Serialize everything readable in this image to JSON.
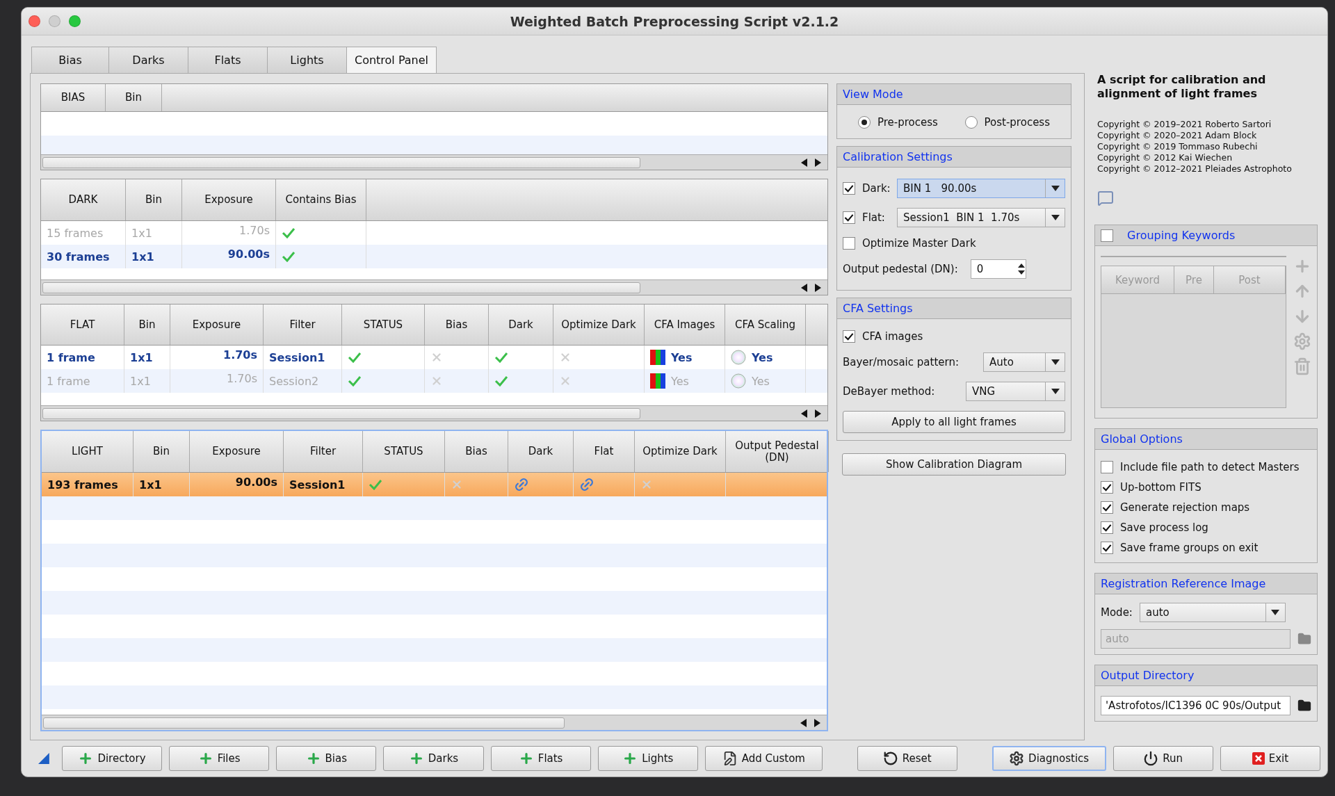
{
  "window": {
    "title": "Weighted Batch Preprocessing Script v2.1.2"
  },
  "tabs": [
    {
      "label": "Bias",
      "selected": false
    },
    {
      "label": "Darks",
      "selected": false
    },
    {
      "label": "Flats",
      "selected": false
    },
    {
      "label": "Lights",
      "selected": false
    },
    {
      "label": "Control Panel",
      "selected": true
    }
  ],
  "tables": [
    {
      "columns": [
        "BIAS",
        "Bin"
      ]
    },
    {
      "columns": [
        "DARK",
        "Bin",
        "Exposure",
        "Contains Bias"
      ],
      "rows": [
        {
          "matched": false,
          "selected": false,
          "cells": [
            {
              "kind": "text",
              "text": "15 frames"
            },
            {
              "kind": "text",
              "text": "1x1"
            },
            {
              "kind": "number",
              "text": "1.70s"
            },
            {
              "kind": "check"
            }
          ]
        },
        {
          "matched": true,
          "selected": false,
          "cells": [
            {
              "kind": "text",
              "text": "30 frames"
            },
            {
              "kind": "text",
              "text": "1x1"
            },
            {
              "kind": "number",
              "text": "90.00s"
            },
            {
              "kind": "check"
            }
          ]
        }
      ]
    },
    {
      "columns": [
        "FLAT",
        "Bin",
        "Exposure",
        "Filter",
        "STATUS",
        "Bias",
        "Dark",
        "Optimize Dark",
        "CFA Images",
        "CFA Scaling"
      ],
      "rows": [
        {
          "matched": true,
          "selected": false,
          "cells": [
            {
              "kind": "text",
              "text": "1 frame"
            },
            {
              "kind": "text",
              "text": "1x1"
            },
            {
              "kind": "number",
              "text": "1.70s"
            },
            {
              "kind": "text",
              "text": "Session1"
            },
            {
              "kind": "check"
            },
            {
              "kind": "cross"
            },
            {
              "kind": "check"
            },
            {
              "kind": "cross"
            },
            {
              "kind": "cfa",
              "text": "Yes"
            },
            {
              "kind": "scaling",
              "text": "Yes"
            }
          ]
        },
        {
          "matched": false,
          "selected": false,
          "cells": [
            {
              "kind": "text",
              "text": "1 frame"
            },
            {
              "kind": "text",
              "text": "1x1"
            },
            {
              "kind": "number",
              "text": "1.70s"
            },
            {
              "kind": "text",
              "text": "Session2"
            },
            {
              "kind": "check"
            },
            {
              "kind": "cross"
            },
            {
              "kind": "check"
            },
            {
              "kind": "cross"
            },
            {
              "kind": "cfa",
              "text": "Yes"
            },
            {
              "kind": "scaling",
              "text": "Yes"
            }
          ]
        }
      ]
    },
    {
      "columns": [
        "LIGHT",
        "Bin",
        "Exposure",
        "Filter",
        "STATUS",
        "Bias",
        "Dark",
        "Flat",
        "Optimize Dark",
        "Output Pedestal (DN)"
      ],
      "rows": [
        {
          "selected": true,
          "cells": [
            {
              "kind": "text",
              "text": "193 frames"
            },
            {
              "kind": "text",
              "text": "1x1"
            },
            {
              "kind": "number",
              "text": "90.00s"
            },
            {
              "kind": "text",
              "text": "Session1"
            },
            {
              "kind": "check"
            },
            {
              "kind": "cross"
            },
            {
              "kind": "link"
            },
            {
              "kind": "link"
            },
            {
              "kind": "cross"
            },
            {
              "kind": "empty"
            }
          ]
        }
      ]
    }
  ],
  "view_mode": {
    "title": "View Mode",
    "options": [
      {
        "label": "Pre-process",
        "selected": true
      },
      {
        "label": "Post-process",
        "selected": false
      }
    ]
  },
  "calibration_settings": {
    "title": "Calibration Settings",
    "dark": {
      "label": "Dark:",
      "checked": true,
      "value": "BIN 1   90.00s",
      "focused": true
    },
    "flat": {
      "label": "Flat:",
      "checked": true,
      "value": "Session1  BIN 1  1.70s",
      "focused": false
    },
    "optimize": {
      "label": "Optimize Master Dark",
      "checked": false
    },
    "pedestal": {
      "label": "Output pedestal (DN):",
      "value": "0"
    }
  },
  "cfa_settings": {
    "title": "CFA Settings",
    "cfa_images": {
      "label": "CFA images",
      "checked": true
    },
    "bayer": {
      "label": "Bayer/mosaic pattern:",
      "value": "Auto"
    },
    "debayer": {
      "label": "DeBayer method:",
      "value": "VNG"
    },
    "apply_button": "Apply to all light frames"
  },
  "show_diagram_button": "Show Calibration Diagram",
  "about": {
    "heading": "A script for calibration and alignment of light frames",
    "copyrights": [
      "Copyright © 2019–2021 Roberto Sartori",
      "Copyright © 2020–2021 Adam Block",
      "Copyright © 2019 Tommaso Rubechi",
      "Copyright © 2012 Kai Wiechen",
      "Copyright © 2012–2021 Pleiades Astrophoto"
    ]
  },
  "grouping_keywords": {
    "title": "Grouping Keywords",
    "checked": false,
    "columns": [
      "Keyword",
      "Pre",
      "Post"
    ]
  },
  "global_options": {
    "title": "Global Options",
    "options": [
      {
        "label": "Include file path to detect Masters",
        "checked": false
      },
      {
        "label": "Up-bottom FITS",
        "checked": true
      },
      {
        "label": "Generate rejection maps",
        "checked": true
      },
      {
        "label": "Save process log",
        "checked": true
      },
      {
        "label": "Save frame groups on exit",
        "checked": true
      }
    ]
  },
  "registration": {
    "title": "Registration Reference Image",
    "mode_label": "Mode:",
    "mode_value": "auto",
    "path_placeholder": "auto"
  },
  "output_directory": {
    "title": "Output Directory",
    "value": "'Astrofotos/IC1396 0C 90s/Output"
  },
  "buttons": [
    {
      "label": "Directory",
      "kind": "add",
      "focused": false
    },
    {
      "label": "Files",
      "kind": "add",
      "focused": false
    },
    {
      "label": "Bias",
      "kind": "add",
      "focused": false
    },
    {
      "label": "Darks",
      "kind": "add",
      "focused": false
    },
    {
      "label": "Flats",
      "kind": "add",
      "focused": false
    },
    {
      "label": "Lights",
      "kind": "add",
      "focused": false
    },
    {
      "label": "Add Custom",
      "kind": "custom",
      "focused": false
    },
    {
      "label": "Reset",
      "kind": "reset",
      "focused": false
    },
    {
      "label": "Diagnostics",
      "kind": "diagnostics",
      "focused": true
    },
    {
      "label": "Run",
      "kind": "run",
      "focused": false
    },
    {
      "label": "Exit",
      "kind": "exit",
      "focused": false
    }
  ]
}
